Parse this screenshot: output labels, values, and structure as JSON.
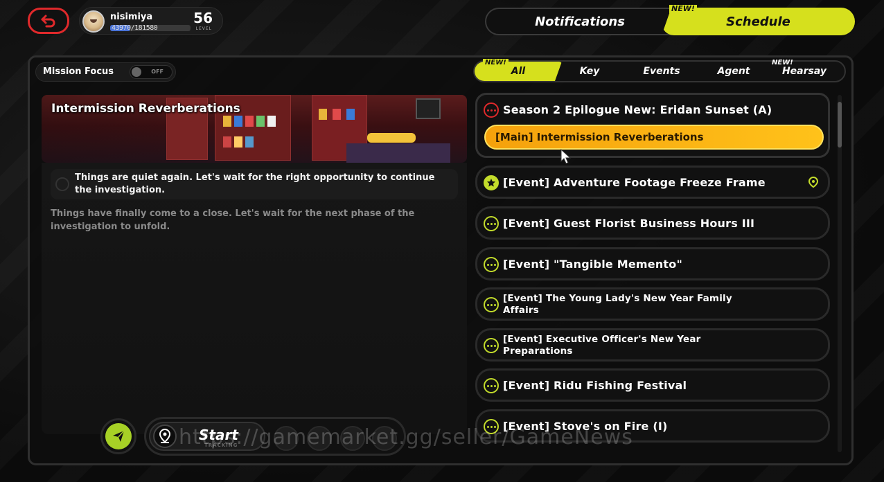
{
  "player": {
    "name": "nisimiya",
    "xp_current": "43970",
    "xp_total": "/181580",
    "xp_fraction": 0.24,
    "level": "56",
    "level_label": "LEVEL"
  },
  "top_tabs": {
    "notifications": "Notifications",
    "schedule": "Schedule",
    "schedule_badge": "NEW!",
    "active": "Schedule"
  },
  "mission_focus": {
    "label": "Mission Focus",
    "state": "OFF"
  },
  "filter_tabs": [
    {
      "label": "All",
      "badge": "NEW!",
      "active": true
    },
    {
      "label": "Key",
      "badge": "",
      "active": false
    },
    {
      "label": "Events",
      "badge": "",
      "active": false
    },
    {
      "label": "Agent",
      "badge": "",
      "active": false
    },
    {
      "label": "Hearsay",
      "badge": "NEW!",
      "active": false
    }
  ],
  "detail": {
    "title": "Intermission Reverberations",
    "objective": "Things are quiet again. Let's wait for the right opportunity to continue the investigation.",
    "description": "Things have finally come to a close. Let's wait for the next phase of the investigation to unfold.",
    "start_label": "Start",
    "tracking_label": "TRACKING"
  },
  "quests": [
    {
      "title": "Season 2 Epilogue New: Eridan Sunset (A)",
      "icon": "dots-icon-red",
      "sub": "[Main] Intermission Reverberations"
    },
    {
      "title": "[Event] Adventure Footage Freeze Frame",
      "icon": "star-icon"
    },
    {
      "title": "[Event] Guest Florist Business Hours III",
      "icon": "dots-icon"
    },
    {
      "title": "[Event] \"Tangible Memento\"",
      "icon": "dots-icon"
    },
    {
      "title": "[Event] The Young Lady's New Year Family Affairs",
      "icon": "dots-icon"
    },
    {
      "title": "[Event] Executive Officer's New Year Preparations",
      "icon": "dots-icon"
    },
    {
      "title": "[Event] Ridu Fishing Festival",
      "icon": "dots-icon"
    },
    {
      "title": "[Event] Stove's on Fire (I)",
      "icon": "dots-icon"
    }
  ],
  "watermark": "https://gamemarket.gg/seller/GameNews",
  "colors": {
    "accent": "#d6e01d",
    "active_quest": "#ffc21a",
    "back": "#e0292b"
  }
}
